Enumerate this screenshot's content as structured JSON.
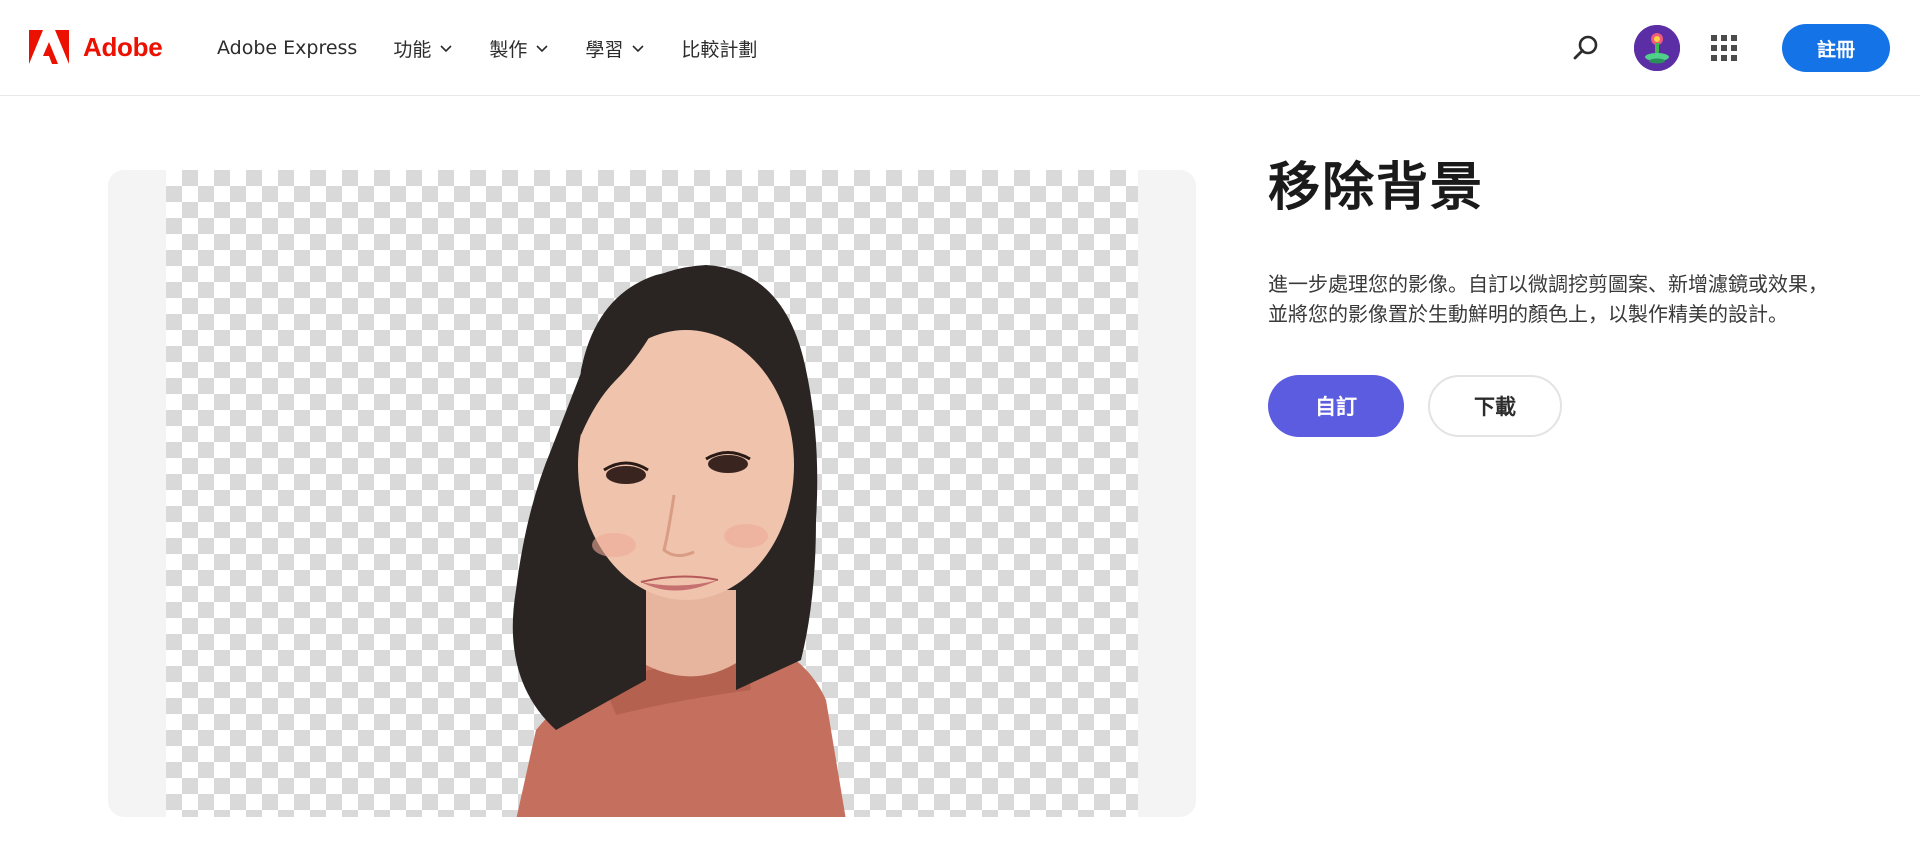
{
  "brand": {
    "name": "Adobe",
    "logo_icon": "adobe-logo-icon",
    "color": "#eb1000"
  },
  "nav": {
    "items": [
      {
        "label": "Adobe Express",
        "has_dropdown": false
      },
      {
        "label": "功能",
        "has_dropdown": true
      },
      {
        "label": "製作",
        "has_dropdown": true
      },
      {
        "label": "學習",
        "has_dropdown": true
      },
      {
        "label": "比較計劃",
        "has_dropdown": false
      }
    ]
  },
  "header_actions": {
    "search_icon": "search-icon",
    "avatar_icon": "user-avatar",
    "apps_icon": "app-grid-icon",
    "signup_label": "註冊",
    "signup_color": "#1473e6"
  },
  "preview": {
    "background": "transparent-checkerboard",
    "subject": "portrait-of-girl-background-removed"
  },
  "main": {
    "title": "移除背景",
    "description": "進一步處理您的影像。自訂以微調挖剪圖案、新增濾鏡或效果，並將您的影像置於生動鮮明的顏色上，以製作精美的設計。",
    "primary_button": "自訂",
    "secondary_button": "下載",
    "primary_color": "#5c5ce0"
  }
}
